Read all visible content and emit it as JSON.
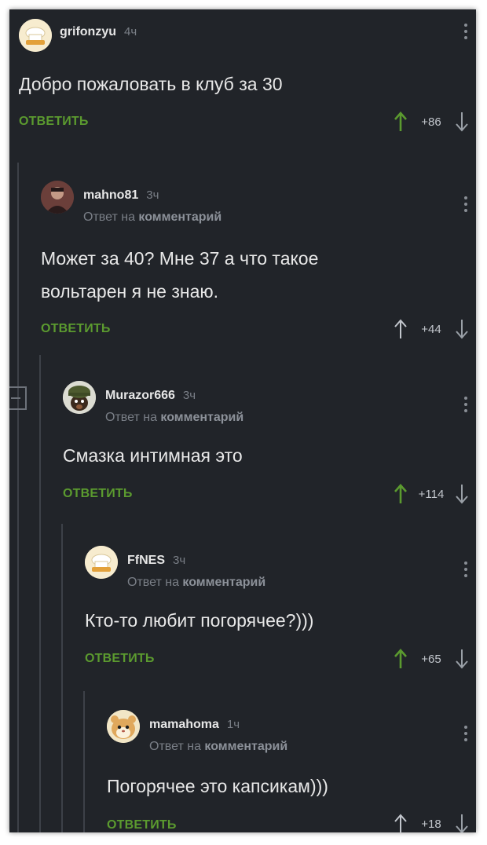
{
  "colors": {
    "background": "#212429",
    "accent_green": "#5b9a2f",
    "text": "#e8e8e8",
    "muted": "#7a7f87"
  },
  "comments": [
    {
      "username": "grifonzyu",
      "time": "4ч",
      "reply_prefix": "",
      "reply_target": "",
      "text": "Добро пожаловать в клуб за 30",
      "reply_label": "ОТВЕТИТЬ",
      "score": "+86",
      "upvoted": true,
      "avatar_icon": "chef-hat-avatar-icon"
    },
    {
      "username": "mahno81",
      "time": "3ч",
      "reply_prefix": "Ответ на",
      "reply_target": "комментарий",
      "text": "Может за 40? Мне 37 а что такое вольтарен я не знаю.",
      "reply_label": "ОТВЕТИТЬ",
      "score": "+44",
      "upvoted": false,
      "avatar_icon": "user-photo-avatar-icon"
    },
    {
      "username": "Murazor666",
      "time": "3ч",
      "reply_prefix": "Ответ на",
      "reply_target": "комментарий",
      "text": "Смазка интимная это",
      "reply_label": "ОТВЕТИТЬ",
      "score": "+114",
      "upvoted": true,
      "avatar_icon": "soldier-dog-avatar-icon"
    },
    {
      "username": "FfNES",
      "time": "3ч",
      "reply_prefix": "Ответ на",
      "reply_target": "комментарий",
      "text": "Кто-то любит погорячее?)))",
      "reply_label": "ОТВЕТИТЬ",
      "score": "+65",
      "upvoted": true,
      "avatar_icon": "chef-hat-avatar-icon"
    },
    {
      "username": "mamahoma",
      "time": "1ч",
      "reply_prefix": "Ответ на",
      "reply_target": "комментарий",
      "text": "Погорячее это капсикам)))",
      "reply_label": "ОТВЕТИТЬ",
      "score": "+18",
      "upvoted": false,
      "avatar_icon": "hamster-avatar-icon"
    }
  ]
}
